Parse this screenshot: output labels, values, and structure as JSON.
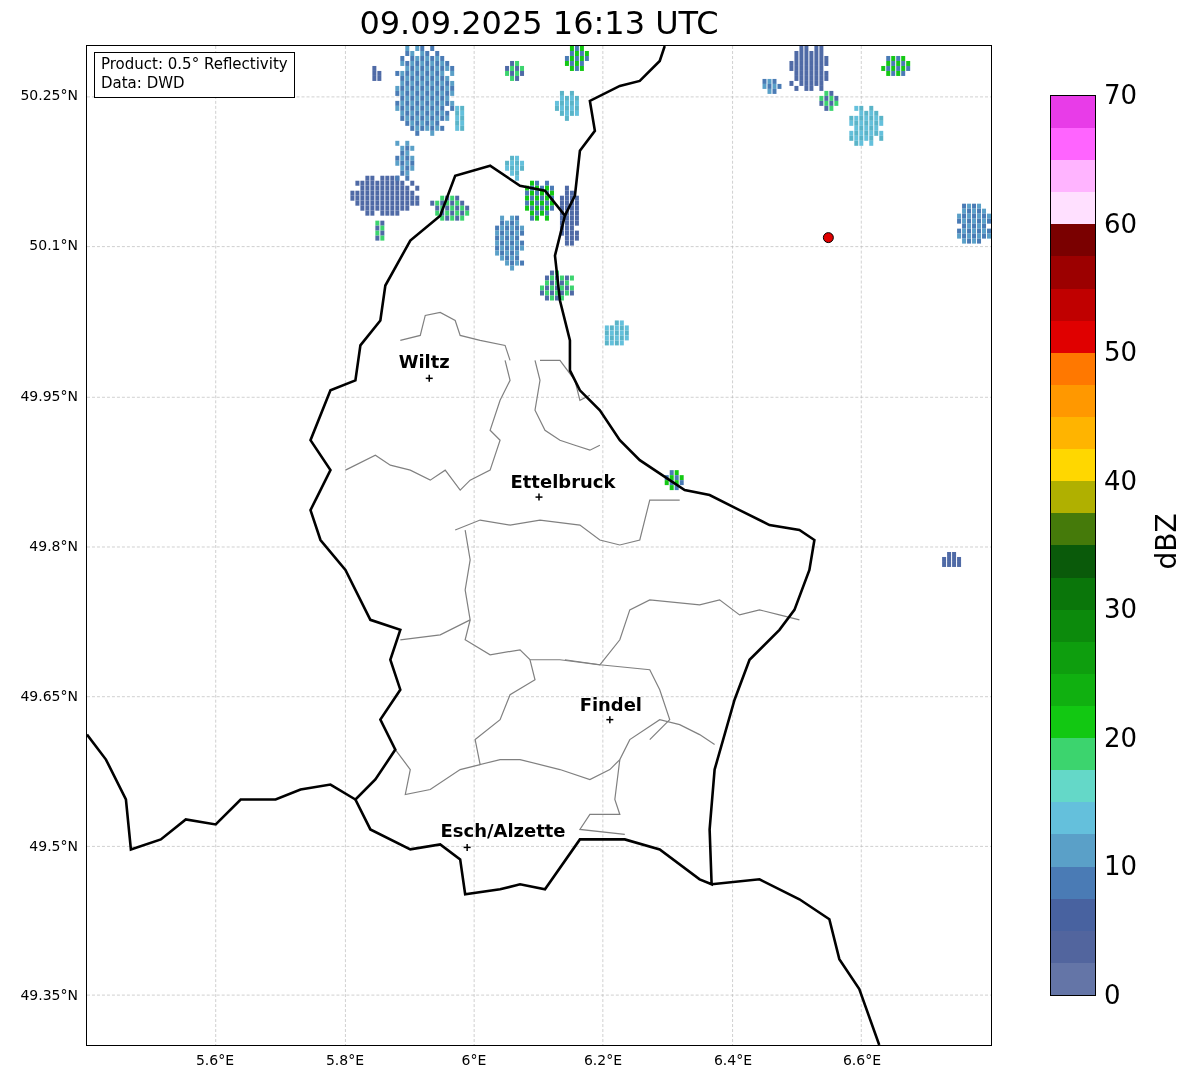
{
  "title": "09.09.2025 16:13 UTC",
  "legend": [
    "Product: 0.5° Reflectivity",
    "Data: DWD"
  ],
  "cities": [
    {
      "name": "Wiltz"
    },
    {
      "name": "Ettelbruck"
    },
    {
      "name": "Findel"
    },
    {
      "name": "Esch/Alzette"
    }
  ],
  "lat_ticks": [
    "50.25°N",
    "50.1°N",
    "49.95°N",
    "49.8°N",
    "49.65°N",
    "49.5°N",
    "49.35°N"
  ],
  "lon_ticks": [
    "5.6°E",
    "5.8°E",
    "6°E",
    "6.2°E",
    "6.4°E",
    "6.6°E"
  ],
  "colorbar": {
    "label": "dBZ",
    "ticks": [
      "70",
      "60",
      "50",
      "40",
      "30",
      "20",
      "10",
      "0"
    ],
    "segments": [
      {
        "color": "#6475a7"
      },
      {
        "color": "#52659e"
      },
      {
        "color": "#4862a0"
      },
      {
        "color": "#4a7bb5"
      },
      {
        "color": "#5aa0c8"
      },
      {
        "color": "#64c0dc"
      },
      {
        "color": "#64d8c8"
      },
      {
        "color": "#3cd46e"
      },
      {
        "color": "#12c812"
      },
      {
        "color": "#10b010"
      },
      {
        "color": "#0e9e0e"
      },
      {
        "color": "#0c8a0c"
      },
      {
        "color": "#0a760a"
      },
      {
        "color": "#0a5a0a"
      },
      {
        "color": "#457a0a"
      },
      {
        "color": "#b0b000"
      },
      {
        "color": "#ffd700"
      },
      {
        "color": "#ffb400"
      },
      {
        "color": "#ff9800"
      },
      {
        "color": "#ff7800"
      },
      {
        "color": "#e00000"
      },
      {
        "color": "#c00000"
      },
      {
        "color": "#9c0000"
      },
      {
        "color": "#7a0000"
      },
      {
        "color": "#ffe0ff"
      },
      {
        "color": "#ffb4ff"
      },
      {
        "color": "#ff64ff"
      },
      {
        "color": "#e83ce8"
      }
    ]
  }
}
